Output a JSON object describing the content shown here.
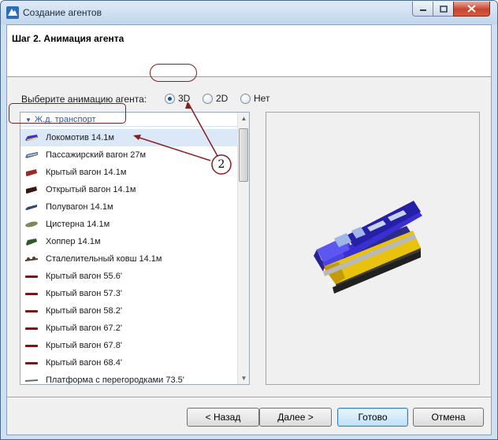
{
  "window": {
    "title": "Создание агентов"
  },
  "header": {
    "step_title": "Шаг 2. Анимация агента"
  },
  "animation_choice": {
    "label": "Выберите анимацию агента:",
    "options": [
      {
        "label": "3D",
        "selected": true
      },
      {
        "label": "2D",
        "selected": false
      },
      {
        "label": "Нет",
        "selected": false
      }
    ]
  },
  "list": {
    "group": "Ж.д. транспорт",
    "items": [
      {
        "label": "Локомотив 14.1м",
        "icon": "locomotive-icon",
        "selected": true
      },
      {
        "label": "Пассажирский вагон 27м",
        "icon": "passenger-car-icon"
      },
      {
        "label": "Крытый вагон 14.1м",
        "icon": "boxcar-icon"
      },
      {
        "label": "Открытый вагон 14.1м",
        "icon": "open-wagon-icon"
      },
      {
        "label": "Полувагон 14.1м",
        "icon": "gondola-icon"
      },
      {
        "label": "Цистерна 14.1м",
        "icon": "tank-car-icon"
      },
      {
        "label": "Хоппер 14.1м",
        "icon": "hopper-icon"
      },
      {
        "label": "Сталелительный ковш 14.1м",
        "icon": "ladle-car-icon"
      },
      {
        "label": "Крытый вагон 55.6'",
        "icon": "boxcar-icon"
      },
      {
        "label": "Крытый вагон 57.3'",
        "icon": "boxcar-icon"
      },
      {
        "label": "Крытый вагон 58.2'",
        "icon": "boxcar-icon"
      },
      {
        "label": "Крытый вагон 67.2'",
        "icon": "boxcar-icon"
      },
      {
        "label": "Крытый вагон 67.8'",
        "icon": "boxcar-icon"
      },
      {
        "label": "Крытый вагон 68.4'",
        "icon": "boxcar-icon"
      },
      {
        "label": "Платформа с перегородками 73.5'",
        "icon": "flatcar-icon"
      }
    ]
  },
  "callout": {
    "number": "2"
  },
  "buttons": {
    "back": "< Назад",
    "next": "Далее >",
    "finish": "Готово",
    "cancel": "Отмена"
  },
  "colors": {
    "highlight": "#8b1c1c",
    "selection": "#dbe8f8",
    "group_text": "#2a5aa7",
    "locomotive_body": "#3a2fd0",
    "locomotive_stripe": "#f2d02a"
  }
}
